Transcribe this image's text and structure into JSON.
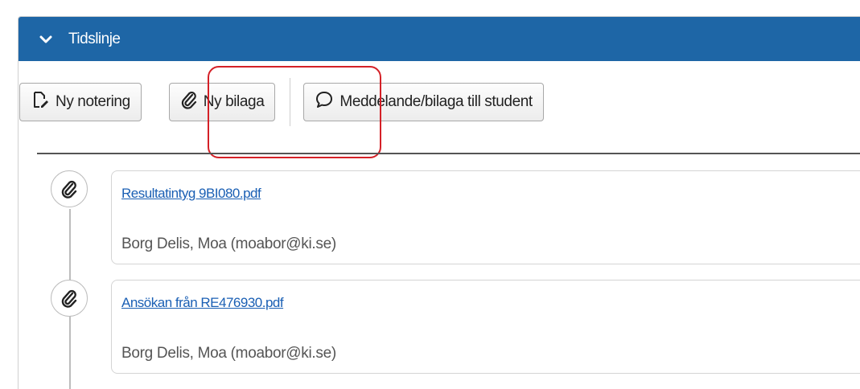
{
  "panel": {
    "title": "Tidslinje"
  },
  "toolbar": {
    "new_note_label": "Ny notering",
    "new_attachment_label": "Ny bilaga",
    "message_label": "Meddelande/bilaga till student"
  },
  "timeline": {
    "items": [
      {
        "file_name": "Resultatintyg 9BI080.pdf",
        "author": "Borg Delis, Moa (moabor@ki.se)",
        "icon": "paperclip-icon"
      },
      {
        "file_name": "Ansökan från RE476930.pdf",
        "author": "Borg Delis, Moa (moabor@ki.se)",
        "icon": "paperclip-icon"
      }
    ]
  },
  "colors": {
    "header_bg": "#1e66a6",
    "highlight": "#d42027",
    "link": "#1a5fb4"
  }
}
